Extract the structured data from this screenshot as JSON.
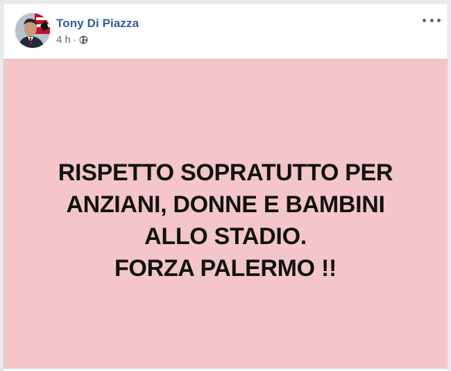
{
  "post": {
    "author": "Tony Di Piazza",
    "time": "4 h",
    "separator": "·",
    "privacy_icon": "globe-icon",
    "more_icon": "more-options-icon",
    "background_color": "#f4c6c9",
    "text_lines": [
      "RISPETTO SOPRATUTTO PER",
      "ANZIANI, DONNE E BAMBINI",
      "ALLO STADIO.",
      "FORZA PALERMO !!"
    ]
  }
}
